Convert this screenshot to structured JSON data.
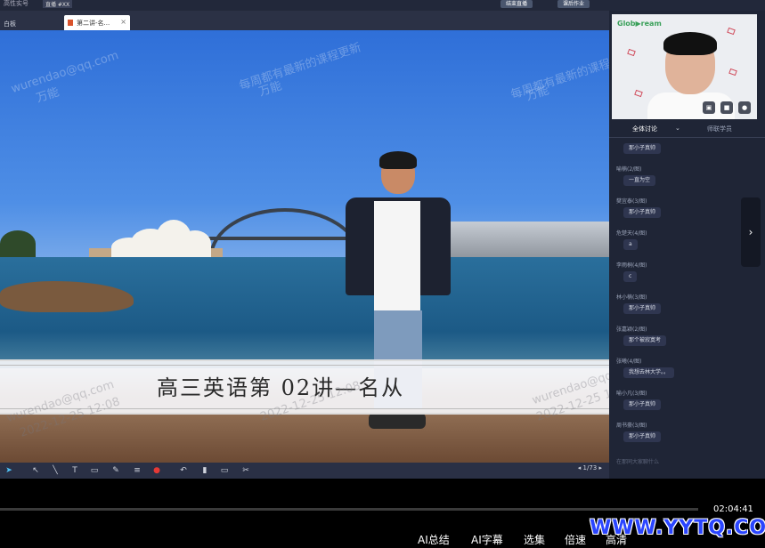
{
  "topbar": {
    "app_title": "高性实号",
    "badge": "直播 #XX",
    "buttons": [
      "结束直播",
      "课后作业"
    ]
  },
  "tabs": {
    "board_label": "白板",
    "file_tab_label": "第二讲-名..."
  },
  "slide": {
    "caption": "高三英语第 02讲—名从",
    "watermarks": [
      "wurendao@qq.com",
      "2022-12-25 12:08",
      "每周都有最新的课程更新",
      "万能"
    ]
  },
  "toolbar": {
    "page_indicator": "1/73"
  },
  "camera": {
    "logo": "Glob▶ream"
  },
  "side_tabs": {
    "all_chat": "全体讨论",
    "only_teacher": "师联学员"
  },
  "chat": [
    {
      "name": "",
      "text": "那小子真帅"
    },
    {
      "name": "喻楠(2/图)",
      "text": "一直为空"
    },
    {
      "name": "樊宜泰(3/图)",
      "text": "那小子真帅"
    },
    {
      "name": "危楚天(4/图)",
      "text": "a"
    },
    {
      "name": "李雨桐(4/图)",
      "text": "c"
    },
    {
      "name": "林小楠(3/图)",
      "text": "那小子真帅"
    },
    {
      "name": "张嘉颖(2/图)",
      "text": "那个被寂寞考"
    },
    {
      "name": "张曦(4/图)",
      "text": "我想去林大学。。"
    },
    {
      "name": "喻小凡(3/图)",
      "text": "那小子真帅"
    },
    {
      "name": "周书豪(3/图)",
      "text": "那小子真帅"
    }
  ],
  "chat_input_placeholder": "在那同大家聊什么",
  "player": {
    "current_time": "02:04:41",
    "buttons": [
      "AI总结",
      "AI字幕",
      "选集",
      "倍速",
      "高清"
    ]
  },
  "brand_watermark": "WWW.YYTQ.COM",
  "colors": {
    "app_dark": "#22283a",
    "side_panel": "#1f2536",
    "brand_blue": "#2a45ff"
  }
}
